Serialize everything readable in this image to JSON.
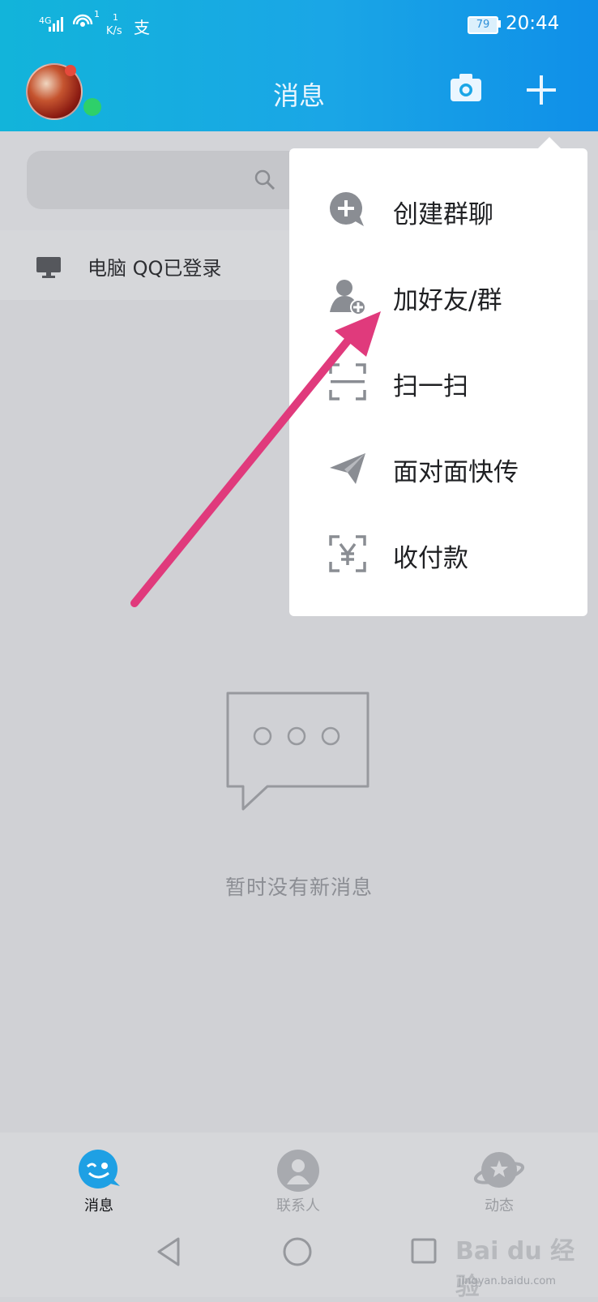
{
  "status_bar": {
    "network": "4G",
    "hotspot_count": "1",
    "speed_value": "1",
    "speed_unit": "K/s",
    "extra_icon": "支",
    "battery": "79",
    "time": "20:44"
  },
  "header": {
    "title": "消息",
    "camera_icon": "camera-icon",
    "plus_icon": "plus-icon"
  },
  "pc_status": {
    "label": "电脑 QQ已登录"
  },
  "empty_state": {
    "text": "暂时没有新消息"
  },
  "menu": {
    "items": [
      {
        "label": "创建群聊",
        "icon": "group-chat-add-icon"
      },
      {
        "label": "加好友/群",
        "icon": "add-friend-icon"
      },
      {
        "label": "扫一扫",
        "icon": "scan-icon"
      },
      {
        "label": "面对面快传",
        "icon": "paper-plane-icon"
      },
      {
        "label": "收付款",
        "icon": "payment-icon"
      }
    ]
  },
  "tabs": [
    {
      "label": "消息",
      "icon": "message-tab-icon",
      "active": true
    },
    {
      "label": "联系人",
      "icon": "contacts-tab-icon",
      "active": false
    },
    {
      "label": "动态",
      "icon": "planet-tab-icon",
      "active": false
    }
  ],
  "watermark": {
    "logo": "Bai du 经验",
    "text": "jingyan.baidu.com"
  },
  "colors": {
    "header": "#1aa6e6",
    "arrow": "#e03a7c",
    "online": "#2ed06a"
  }
}
